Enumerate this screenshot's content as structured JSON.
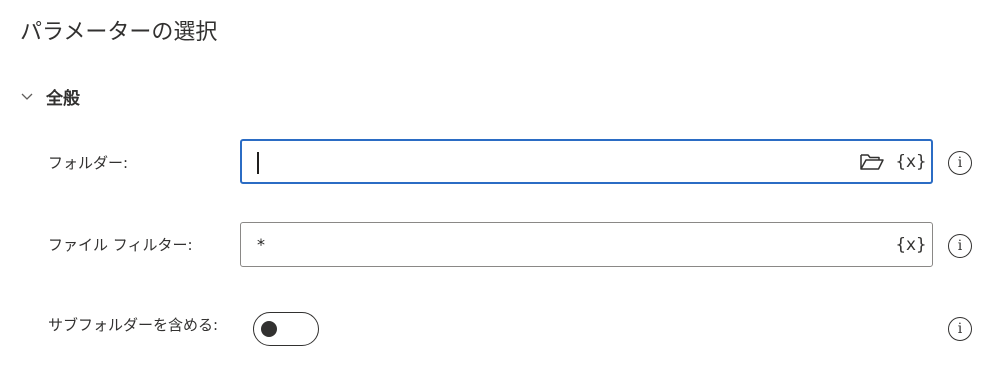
{
  "title": "パラメーターの選択",
  "section": {
    "label": "全般",
    "expanded": true,
    "chevron_icon": "chevron-down-icon"
  },
  "folder": {
    "label": "フォルダー:",
    "value": "",
    "folder_icon": "folder-open-icon",
    "variable_button": "{x}"
  },
  "file_filter": {
    "label": "ファイル フィルター:",
    "value": "*",
    "variable_button": "{x}"
  },
  "include_subfolders": {
    "label": "サブフォルダーを含める:",
    "enabled": false
  },
  "info_glyph": "i",
  "colors": {
    "focus_border": "#2b6cc4",
    "border": "#8a8886",
    "text": "#323130"
  }
}
